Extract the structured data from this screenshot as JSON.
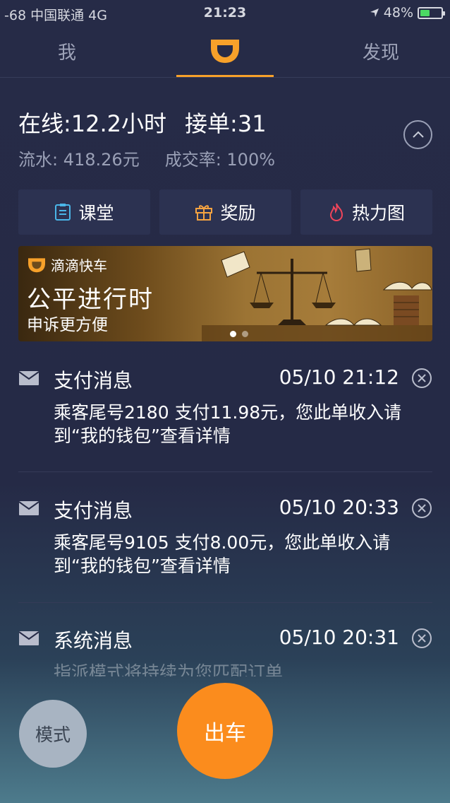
{
  "status_bar": {
    "carrier": "-68 中国联通  4G",
    "time": "21:23",
    "battery_text": "48%",
    "battery_level": 0.48
  },
  "tabs": {
    "me": "我",
    "discover": "发现"
  },
  "stats": {
    "online": "在线:12.2小时",
    "orders": "接单:31",
    "flow": "流水: 418.26元",
    "rate": "成交率: 100%"
  },
  "quick_actions": {
    "classroom": "课堂",
    "rewards": "奖励",
    "heatmap": "热力图"
  },
  "banner": {
    "brand": "滴滴快车",
    "headline": "公平进行时",
    "subline": "申诉更方便",
    "page_count": 2,
    "active_page": 1
  },
  "messages": [
    {
      "title": "支付消息",
      "time": "05/10 21:12",
      "body": "乘客尾号2180 支付11.98元，您此单收入请到“我的钱包”查看详情"
    },
    {
      "title": "支付消息",
      "time": "05/10 20:33",
      "body": "乘客尾号9105 支付8.00元，您此单收入请到“我的钱包”查看详情"
    },
    {
      "title": "系统消息",
      "time": "05/10 20:31",
      "body": "指派模式将持续为您匹配订单"
    }
  ],
  "buttons": {
    "mode": "模式",
    "go": "出车"
  },
  "colors": {
    "accent": "#f7a12a",
    "go_button": "#fb8c1d",
    "background": "#262b47"
  }
}
